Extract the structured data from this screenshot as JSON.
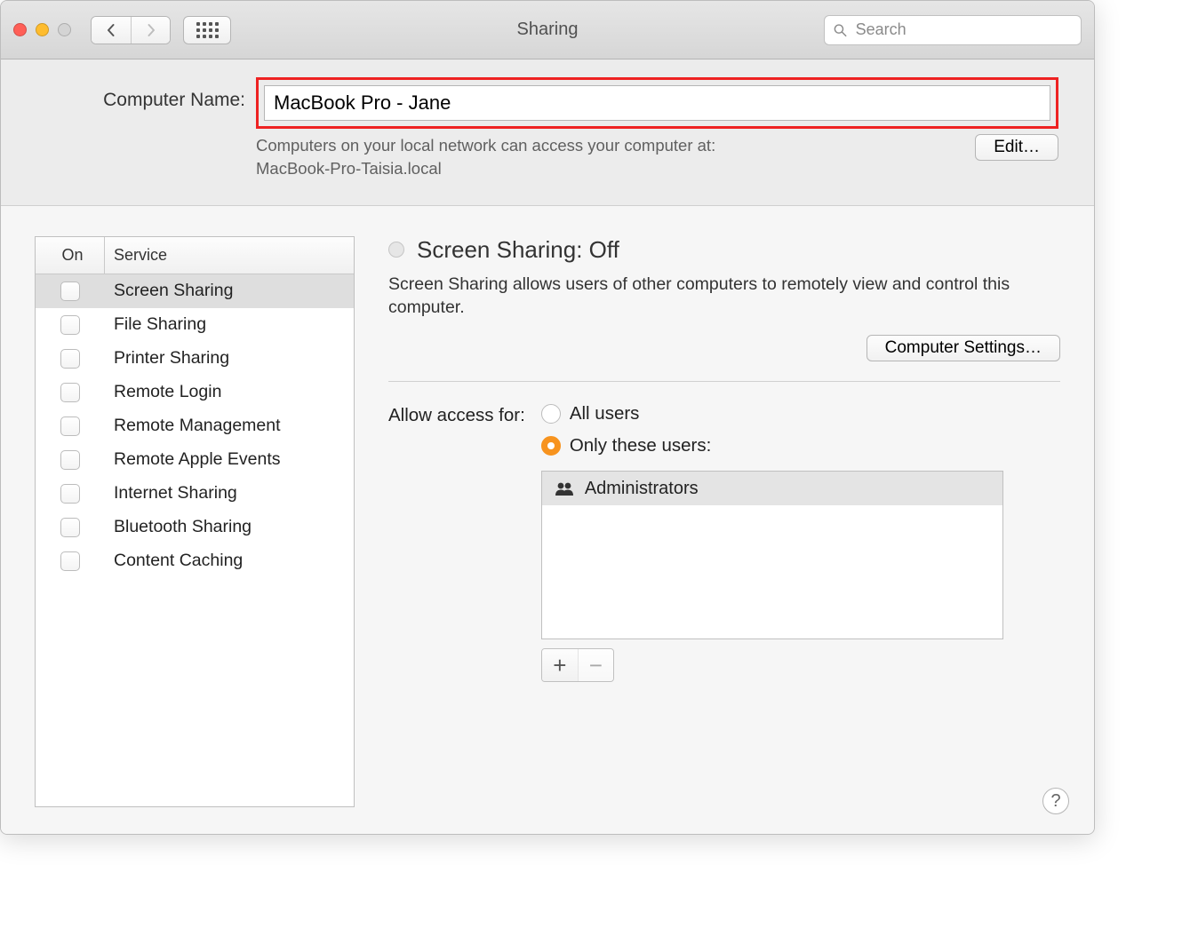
{
  "window": {
    "title": "Sharing",
    "search_placeholder": "Search"
  },
  "header": {
    "computer_name_label": "Computer Name:",
    "computer_name_value": "MacBook Pro - Jane",
    "desc_line1": "Computers on your local network can access your computer at:",
    "desc_line2": "MacBook-Pro-Taisia.local",
    "edit_button": "Edit…"
  },
  "services_list": {
    "col_on": "On",
    "col_service": "Service",
    "items": [
      {
        "label": "Screen Sharing",
        "checked": false,
        "selected": true
      },
      {
        "label": "File Sharing",
        "checked": false,
        "selected": false
      },
      {
        "label": "Printer Sharing",
        "checked": false,
        "selected": false
      },
      {
        "label": "Remote Login",
        "checked": false,
        "selected": false
      },
      {
        "label": "Remote Management",
        "checked": false,
        "selected": false
      },
      {
        "label": "Remote Apple Events",
        "checked": false,
        "selected": false
      },
      {
        "label": "Internet Sharing",
        "checked": false,
        "selected": false
      },
      {
        "label": "Bluetooth Sharing",
        "checked": false,
        "selected": false
      },
      {
        "label": "Content Caching",
        "checked": false,
        "selected": false
      }
    ]
  },
  "detail": {
    "status_title": "Screen Sharing: Off",
    "status_desc": "Screen Sharing allows users of other computers to remotely view and control this computer.",
    "computer_settings_button": "Computer Settings…",
    "access_label": "Allow access for:",
    "radio_all": "All users",
    "radio_only": "Only these users:",
    "radio_selected": "only",
    "userlist": {
      "items": [
        {
          "label": "Administrators"
        }
      ]
    },
    "add_label": "+",
    "remove_label": "−"
  },
  "help_label": "?"
}
